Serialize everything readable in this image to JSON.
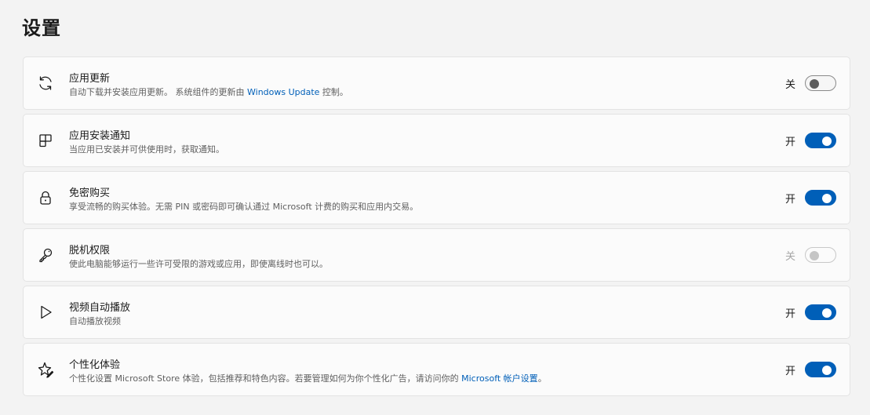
{
  "page": {
    "title": "设置"
  },
  "colors": {
    "accent": "#005fb8",
    "link": "#005fb8"
  },
  "items": [
    {
      "icon": "refresh-icon",
      "title": "应用更新",
      "desc_before": "自动下载并安装应用更新。 系统组件的更新由 ",
      "desc_link": "Windows Update",
      "desc_after": " 控制。",
      "state_label": "关",
      "toggle_on": false,
      "disabled": false
    },
    {
      "icon": "tiles-icon",
      "title": "应用安装通知",
      "desc_before": "当应用已安装并可供使用时，获取通知。",
      "desc_link": "",
      "desc_after": "",
      "state_label": "开",
      "toggle_on": true,
      "disabled": false
    },
    {
      "icon": "lock-icon",
      "title": "免密购买",
      "desc_before": "享受流畅的购买体验。无需 PIN 或密码即可确认通过 Microsoft 计费的购买和应用内交易。",
      "desc_link": "",
      "desc_after": "",
      "state_label": "开",
      "toggle_on": true,
      "disabled": false
    },
    {
      "icon": "key-icon",
      "title": "脱机权限",
      "desc_before": "使此电脑能够运行一些许可受限的游戏或应用，即使离线时也可以。",
      "desc_link": "",
      "desc_after": "",
      "state_label": "关",
      "toggle_on": false,
      "disabled": true
    },
    {
      "icon": "play-icon",
      "title": "视频自动播放",
      "desc_before": "自动播放视频",
      "desc_link": "",
      "desc_after": "",
      "state_label": "开",
      "toggle_on": true,
      "disabled": false
    },
    {
      "icon": "sparkle-edit-icon",
      "title": "个性化体验",
      "desc_before": "个性化设置 Microsoft Store 体验，包括推荐和特色内容。若要管理如何为你个性化广告，请访问你的 ",
      "desc_link": "Microsoft 帐户设置",
      "desc_after": "。",
      "state_label": "开",
      "toggle_on": true,
      "disabled": false
    }
  ]
}
